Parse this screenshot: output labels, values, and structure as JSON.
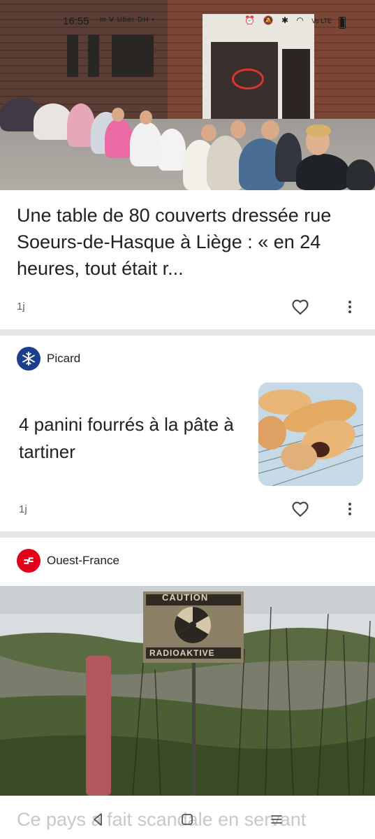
{
  "status_bar": {
    "time": "16:55",
    "app_icons": [
      "m",
      "V",
      "Uber",
      "DH",
      "mail",
      "•"
    ],
    "right_icons": [
      "alarm",
      "mute",
      "bluetooth",
      "wifi",
      "VoLTE",
      "signal",
      "battery"
    ],
    "volte_label": "Vo LTE"
  },
  "cards": [
    {
      "headline": "Une table de 80 couverts dressée rue Soeurs-de-Hasque à Liège : « en 24 heures, tout était r...",
      "age": "1j",
      "image": "street dinner table photo"
    },
    {
      "source": "Picard",
      "source_color": "#1d3e8c",
      "headline": "4 panini fourrés à la pâte à tartiner",
      "age": "1j",
      "image": "panini thumbnail"
    },
    {
      "source": "Ouest-France",
      "source_color": "#e2001a",
      "image": "radioactive warning sign in field",
      "sign_top": "CAUTION",
      "sign_bottom": "RADIOAKTIVE",
      "headline": "Ce pays a fait scandale en servant"
    }
  ],
  "colors": {
    "divider": "#e6e6e6",
    "text": "#202124",
    "meta": "#5f6368"
  }
}
